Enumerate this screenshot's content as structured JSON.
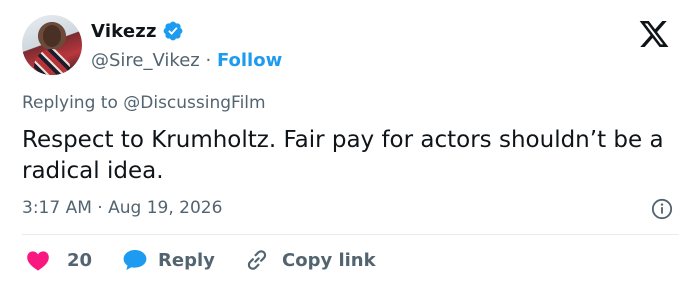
{
  "user": {
    "name": "Vikezz",
    "handle": "@Sire_Vikez",
    "separator": "·",
    "follow_label": "Follow"
  },
  "tweet": {
    "reply_prefix": "Replying to",
    "reply_to": "@DiscussingFilm",
    "text": "Respect to Krumholtz. Fair pay for actors shouldn’t be a radical idea.",
    "time": "3:17 AM",
    "date": "Aug 19, 2026",
    "meta_separator": "·"
  },
  "actions": {
    "like_count": "20",
    "reply_label": "Reply",
    "copy_label": "Copy link"
  },
  "colors": {
    "accent": "#1d9bf0",
    "like": "#f91880",
    "muted": "#536471",
    "text": "#0f1419"
  },
  "icons": {
    "verified": "verified-badge-icon",
    "platform": "x-logo-icon",
    "info": "info-icon",
    "like": "heart-icon",
    "reply": "speech-bubble-icon",
    "copy": "link-icon"
  }
}
